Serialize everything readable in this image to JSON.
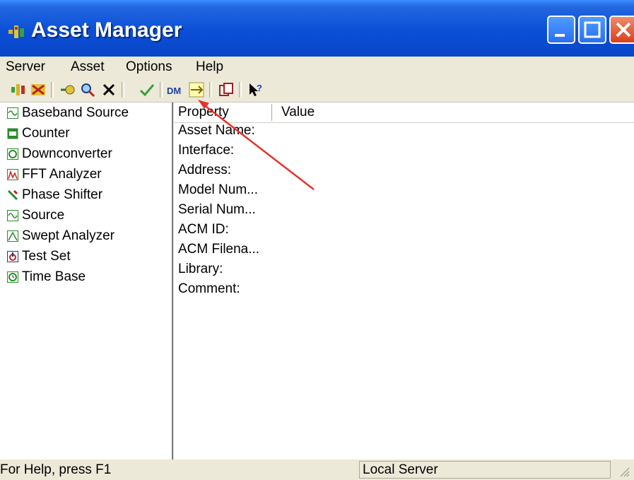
{
  "window": {
    "title": "Asset Manager"
  },
  "menu": {
    "items": [
      "Server",
      "Asset",
      "Options",
      "Help"
    ]
  },
  "toolbar": {
    "buttons": [
      "connect-icon",
      "disconnect-icon",
      "add-asset-icon",
      "find-asset-icon",
      "delete-icon",
      "check-icon",
      "data-icon",
      "arrow-icon",
      "copy-icon",
      "help-icon"
    ]
  },
  "tree": {
    "items": [
      {
        "label": "Baseband Source",
        "icon": "source-icon"
      },
      {
        "label": "Counter",
        "icon": "counter-icon"
      },
      {
        "label": "Downconverter",
        "icon": "downconverter-icon"
      },
      {
        "label": "FFT Analyzer",
        "icon": "fft-analyzer-icon"
      },
      {
        "label": "Phase Shifter",
        "icon": "phase-shifter-icon"
      },
      {
        "label": "Source",
        "icon": "source-icon"
      },
      {
        "label": "Swept Analyzer",
        "icon": "swept-analyzer-icon"
      },
      {
        "label": "Test Set",
        "icon": "test-set-icon"
      },
      {
        "label": "Time Base",
        "icon": "time-base-icon"
      }
    ]
  },
  "properties": {
    "headers": {
      "property": "Property",
      "value": "Value"
    },
    "rows": [
      "Asset Name:",
      "Interface:",
      "Address:",
      "Model Num...",
      "Serial Num...",
      "ACM ID:",
      "ACM Filena...",
      "Library:",
      "Comment:"
    ]
  },
  "status": {
    "help": "For Help, press F1",
    "server": "Local Server"
  },
  "colors": {
    "titlebar": "#0a4fd6",
    "close": "#d9401c",
    "annotation_arrow": "#e8312a"
  }
}
